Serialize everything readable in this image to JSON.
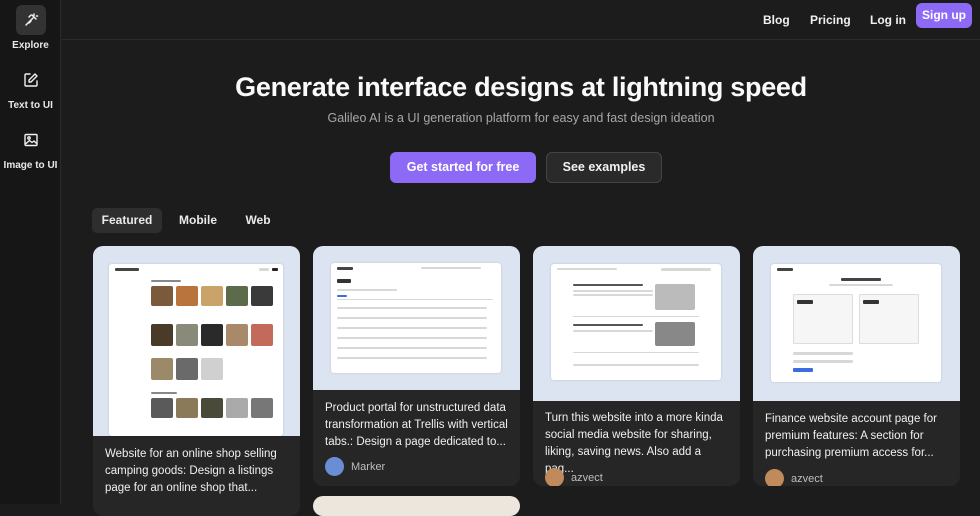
{
  "sidebar": {
    "items": [
      {
        "label": "Explore",
        "icon": "wand-icon"
      },
      {
        "label": "Text to UI",
        "icon": "edit-icon"
      },
      {
        "label": "Image to UI",
        "icon": "image-icon"
      }
    ]
  },
  "topnav": {
    "blog": "Blog",
    "pricing": "Pricing",
    "login": "Log in",
    "signup": "Sign up"
  },
  "hero": {
    "title": "Generate interface designs at lightning speed",
    "subtitle": "Galileo AI is a UI generation platform for easy and fast design ideation",
    "primary_cta": "Get started for free",
    "secondary_cta": "See examples"
  },
  "tabs": [
    {
      "label": "Featured",
      "active": true
    },
    {
      "label": "Mobile",
      "active": false
    },
    {
      "label": "Web",
      "active": false
    }
  ],
  "cards": [
    {
      "text": "Website for an online shop selling camping goods: Design a listings page for an online shop that...",
      "author": ""
    },
    {
      "text": "Product portal for unstructured data transformation at Trellis with vertical tabs.: Design a page dedicated to...",
      "author": "Marker"
    },
    {
      "text": "Turn this website into a more kinda social media website for sharing, liking, saving news. Also add a pag...",
      "author": "azvect"
    },
    {
      "text": "Finance website account page for premium features: A section for purchasing premium access for...",
      "author": "azvect"
    }
  ],
  "colors": {
    "accent": "#8d6af6",
    "background": "#1c1c1c",
    "card": "#262626",
    "preview_bg": "#dbe4f0"
  }
}
